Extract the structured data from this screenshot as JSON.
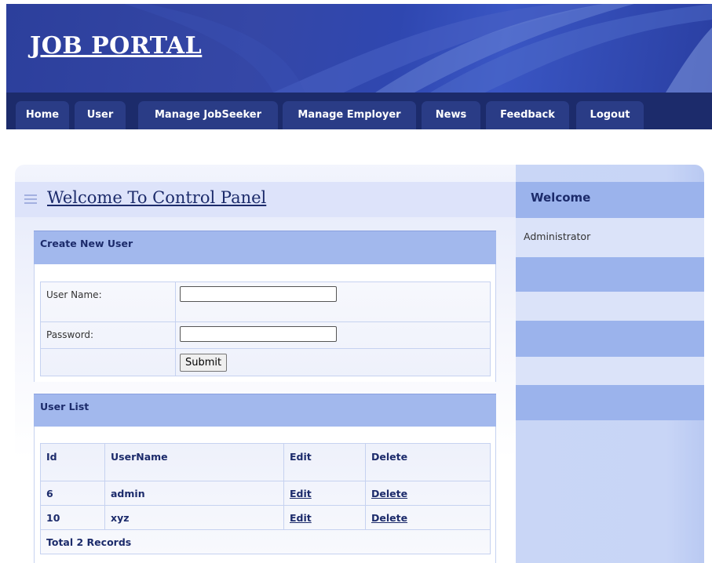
{
  "header": {
    "site_title": "JOB PORTAL"
  },
  "nav": {
    "items": [
      "Home",
      "User",
      "Manage JobSeeker",
      "Manage Employer",
      "News",
      "Feedback",
      "Logout"
    ]
  },
  "main": {
    "title": "Welcome To Control Panel",
    "create_user": {
      "heading": "Create New User",
      "username_label": "User Name:",
      "username_value": "",
      "password_label": "Password:",
      "password_value": "",
      "submit_label": "Submit"
    },
    "user_list": {
      "heading": "User List",
      "columns": [
        "Id",
        "UserName",
        "Edit",
        "Delete"
      ],
      "rows": [
        {
          "id": "6",
          "username": "admin",
          "edit": "Edit",
          "delete": "Delete"
        },
        {
          "id": "10",
          "username": "xyz",
          "edit": "Edit",
          "delete": "Delete"
        }
      ],
      "footer": "Total 2 Records"
    }
  },
  "sidebar": {
    "title": "Welcome",
    "user": "Administrator"
  },
  "icons": {
    "menu": "menu-icon"
  },
  "colors": {
    "header_blue": "#2f47b0",
    "nav_dark": "#1c2b6b",
    "section_header": "#a2b8ed",
    "sidebar": "#c9d6f6",
    "text_dark": "#1c2b6b"
  }
}
